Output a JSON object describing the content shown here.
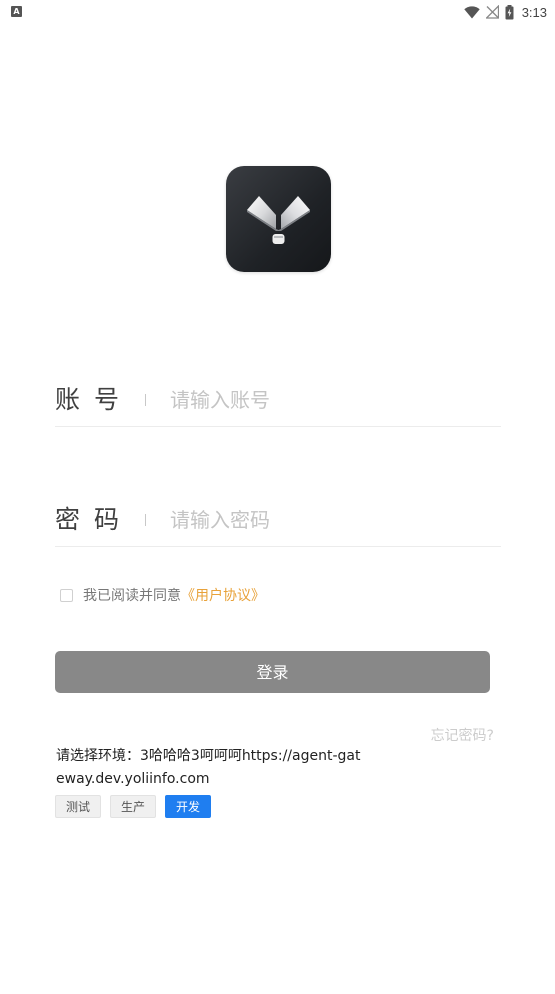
{
  "status_bar": {
    "app_icon": "a-notification-icon",
    "wifi_icon": "wifi-icon",
    "signal_icon": "no-signal-icon",
    "battery_icon": "battery-charging-icon",
    "time": "3:13"
  },
  "logo": {
    "icon": "app-logo-icon"
  },
  "account": {
    "label": "账号",
    "placeholder": "请输入账号",
    "value": ""
  },
  "password": {
    "label": "密码",
    "placeholder": "请输入密码",
    "value": ""
  },
  "agreement": {
    "checked": false,
    "text": "我已阅读并同意",
    "link": "《用户协议》"
  },
  "login_button": {
    "label": "登录"
  },
  "forgot_password": {
    "label": "忘记密码?"
  },
  "environment": {
    "prompt": "请选择环境：3哈哈哈3呵呵呵https://agent-gateway.dev.yoliinfo.com",
    "options": [
      {
        "label": "测试",
        "selected": false
      },
      {
        "label": "生产",
        "selected": false
      },
      {
        "label": "开发",
        "selected": true
      }
    ]
  },
  "colors": {
    "accent": "#1f7ef0",
    "link": "#e8a23a",
    "button_disabled": "#888888"
  }
}
